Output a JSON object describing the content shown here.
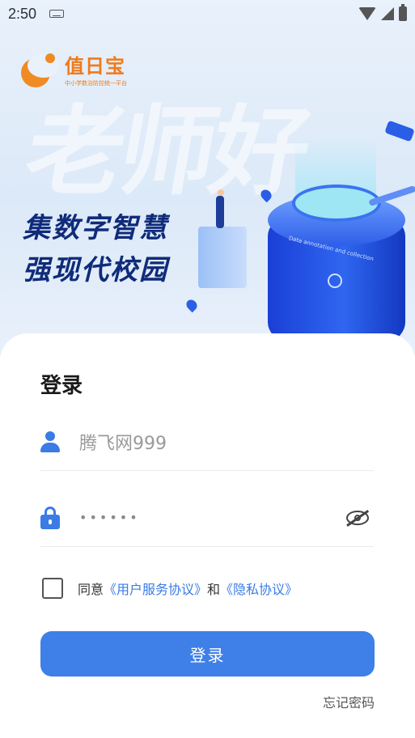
{
  "status_bar": {
    "time": "2:50",
    "icons": [
      "keyboard-icon",
      "wifi-icon",
      "signal-icon",
      "battery-icon"
    ]
  },
  "brand": {
    "name": "值日宝",
    "subtitle": "中小学数治防控统一平台",
    "color": "#f07a1a"
  },
  "hero": {
    "watermark": "老师好",
    "slogan_line1": "集数字智慧",
    "slogan_line2": "强现代校园",
    "device_caption": "Data annotation and collection"
  },
  "login": {
    "title": "登录",
    "username": {
      "value": "腾飞网999",
      "icon": "user-icon"
    },
    "password": {
      "masked_value": "••••••",
      "icon": "lock-icon",
      "toggle_icon": "eye-off-icon"
    },
    "agreement": {
      "checked": false,
      "prefix": "同意",
      "terms_link": "《用户服务协议》",
      "joiner": "和",
      "privacy_link": "《隐私协议》"
    },
    "submit_label": "登录",
    "forgot_label": "忘记密码"
  },
  "colors": {
    "accent": "#3f7fe8",
    "link": "#3a7be6",
    "hero_bg": "#e9f1fb",
    "slogan": "#0f2b7a"
  }
}
